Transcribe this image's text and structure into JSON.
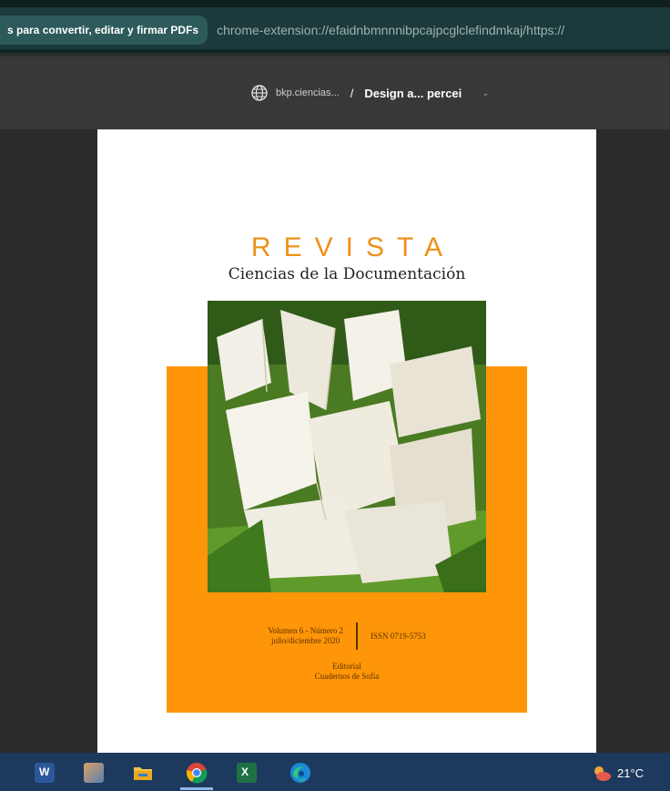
{
  "browser": {
    "extension_label": "s para convertir, editar y firmar PDFs",
    "url": "chrome-extension://efaidnbmnnnibpcajpcglclefindmkaj/https://"
  },
  "pdf_toolbar": {
    "site": "bkp.ciencias...",
    "separator": "/",
    "document": "Design a... percei"
  },
  "cover": {
    "title": "REVISTA",
    "subtitle": "Ciencias de la Documentación",
    "volume": "Volumen 6 - Número 2",
    "period": "julio/diciembre 2020",
    "issn": "ISSN 0719-5753",
    "publisher_line1": "Editorial",
    "publisher_line2": "Cuadernos de Sofía"
  },
  "taskbar": {
    "apps": [
      "word-icon",
      "image-viewer-icon",
      "file-explorer-icon",
      "chrome-icon",
      "excel-icon",
      "edge-icon"
    ],
    "temperature": "21°C"
  },
  "colors": {
    "accent_orange": "#ff9508",
    "title_orange": "#f0901a",
    "address_bar": "#1c3a3b",
    "taskbar": "#1d3a5e"
  }
}
